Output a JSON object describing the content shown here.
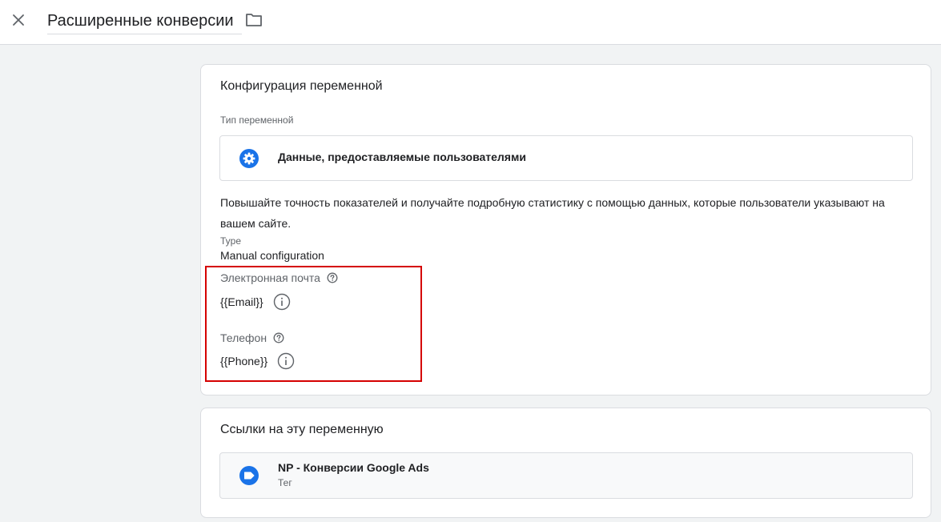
{
  "header": {
    "title": "Расширенные конверсии"
  },
  "config": {
    "title": "Конфигурация переменной",
    "type_label": "Тип переменной",
    "type_name": "Данные, предоставляемые пользователями",
    "description": "Повышайте точность показателей и получайте подробную статистику с помощью данных, которые пользователи указывают на вашем сайте.",
    "type_field_label": "Type",
    "type_field_value": "Manual configuration",
    "email_label": "Электронная почта",
    "email_value": "{{Email}}",
    "phone_label": "Телефон",
    "phone_value": "{{Phone}}"
  },
  "references": {
    "title": "Ссылки на эту переменную",
    "items": [
      {
        "name": "NP - Конверсии Google Ads",
        "kind": "Тег"
      }
    ]
  },
  "colors": {
    "accent_blue": "#1a73e8",
    "highlight_red": "#d50000",
    "icon_gray": "#5f6368"
  },
  "icons": {
    "close": "close-icon",
    "folder": "folder-icon",
    "variable_type": "gear-icon",
    "help": "help-circle-icon",
    "info": "info-icon",
    "tag": "tag-icon"
  }
}
